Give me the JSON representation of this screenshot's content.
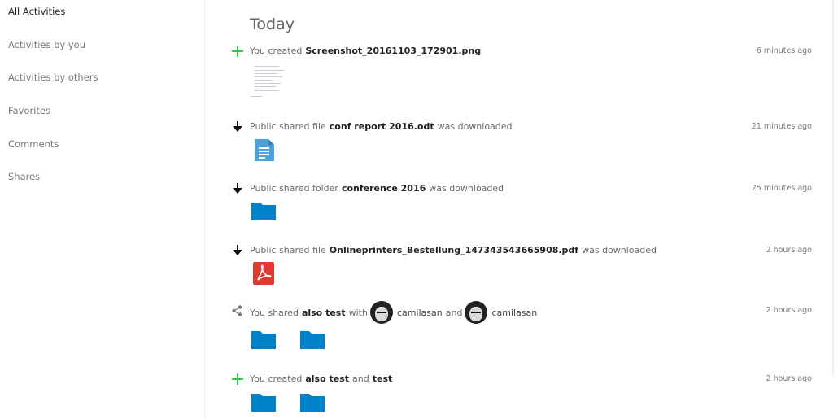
{
  "sidebar": {
    "items": [
      {
        "label": "All Activities",
        "active": true
      },
      {
        "label": "Activities by you"
      },
      {
        "label": "Activities by others"
      },
      {
        "label": "Favorites"
      },
      {
        "label": "Comments"
      },
      {
        "label": "Shares"
      }
    ]
  },
  "main": {
    "heading": "Today",
    "activities": [
      {
        "icon": "plus-icon",
        "pre": "You created",
        "bold": "Screenshot_20161103_172901.png",
        "time": "6 minutes ago"
      },
      {
        "icon": "arrow-down-icon",
        "pre": "Public shared file",
        "bold": "conf report 2016.odt",
        "post": "was downloaded",
        "time": "21 minutes ago"
      },
      {
        "icon": "arrow-down-icon",
        "pre": "Public shared folder",
        "bold": "conference 2016",
        "post": "was downloaded",
        "time": "25 minutes ago"
      },
      {
        "icon": "arrow-down-icon",
        "pre": "Public shared file",
        "bold": "Onlineprinters_Bestellung_147343543665908.pdf",
        "post": "was downloaded",
        "time": "2 hours ago"
      },
      {
        "icon": "share-icon",
        "pre": "You shared",
        "bold": "also test",
        "mid": "with",
        "user1": "camilasan",
        "and": "and",
        "user2": "camilasan",
        "time": "2 hours ago"
      },
      {
        "icon": "plus-icon",
        "pre": "You created",
        "bold": "also test",
        "and": "and",
        "bold2": "test",
        "time": "2 hours ago"
      }
    ]
  },
  "colors": {
    "plus": "#2ecc40",
    "folder": "#0082c9",
    "doc": "#4aa3df",
    "pdf": "#dc3c30"
  }
}
